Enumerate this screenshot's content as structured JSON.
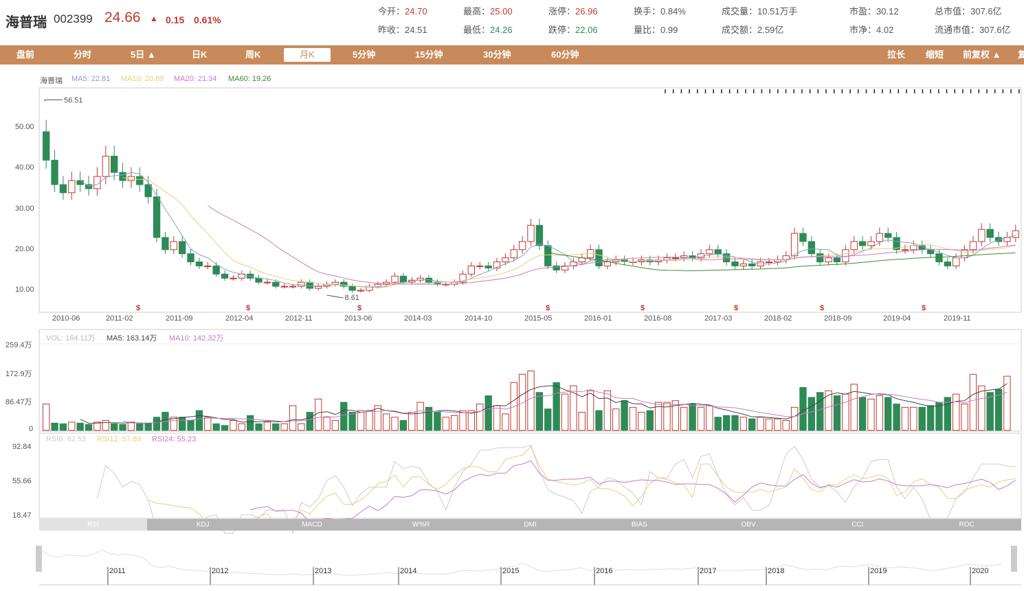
{
  "stock": {
    "name": "海普瑞",
    "code": "002399",
    "price": "24.66",
    "arrow": "▲",
    "change": "0.15",
    "change_pct": "0.61%"
  },
  "quote": {
    "row1": [
      {
        "label": "今开：",
        "value": "24.70",
        "tone": "up"
      },
      {
        "label": "最高：",
        "value": "25.00",
        "tone": "up"
      },
      {
        "label": "涨停：",
        "value": "26.96",
        "tone": "up"
      },
      {
        "label": "换手：",
        "value": "0.84%",
        "tone": "nt"
      },
      {
        "label": "成交量：",
        "value": "10.51万手",
        "tone": "nt"
      },
      {
        "label": "市盈：",
        "value": "30.12",
        "tone": "nt"
      },
      {
        "label": "总市值：",
        "value": "307.6亿",
        "tone": "nt"
      }
    ],
    "row2": [
      {
        "label": "昨收：",
        "value": "24.51",
        "tone": "nt"
      },
      {
        "label": "最低：",
        "value": "24.26",
        "tone": "dn"
      },
      {
        "label": "跌停：",
        "value": "22.06",
        "tone": "dn"
      },
      {
        "label": "量比：",
        "value": "0.99",
        "tone": "nt"
      },
      {
        "label": "成交额：",
        "value": "2.59亿",
        "tone": "nt"
      },
      {
        "label": "市净：",
        "value": "4.02",
        "tone": "nt"
      },
      {
        "label": "流通市值：",
        "value": "307.6亿",
        "tone": "nt"
      }
    ]
  },
  "toolbar": {
    "left": [
      "盘前",
      "分时",
      "5日 ▲",
      "日K",
      "周K",
      "月K",
      "5分钟",
      "15分钟",
      "30分钟",
      "60分钟"
    ],
    "active_index": 5,
    "right": [
      "拉长",
      "缩短",
      "前复权 ▲",
      "复"
    ]
  },
  "kline": {
    "legend": {
      "name": "海普瑞",
      "ma5": "MA5: 22.81",
      "ma10": "MA10: 20.89",
      "ma20": "MA20: 21.34",
      "ma60": "MA60: 19.26"
    },
    "yticks": [
      "50.00",
      "40.00",
      "30.00",
      "20.00",
      "10.00"
    ],
    "xticks": [
      "2010-06",
      "2011-02",
      "2011-09",
      "2012-04",
      "2012-11",
      "2013-06",
      "2014-03",
      "2014-10",
      "2015-05",
      "2016-01",
      "2016-08",
      "2017-03",
      "2018-02",
      "2018-09",
      "2019-04",
      "2019-11"
    ],
    "high_label": "56.51",
    "low_label": "8.61",
    "dividend_mark": "$"
  },
  "volume": {
    "legend": {
      "vol": "VOL: 164.11万",
      "ma5": "MA5: 163.14万",
      "ma10": "MA10: 142.32万"
    },
    "yticks": [
      "259.4万",
      "172.9万",
      "86.47万",
      "0"
    ]
  },
  "rsi": {
    "legend": {
      "rsi6": "RSI6: 62.53",
      "rsi12": "RSI12: 57.89",
      "rsi24": "RSI24: 55.23"
    },
    "yticks": [
      "92.84",
      "55.66",
      "18.47"
    ]
  },
  "indicator_tabs": [
    "RSI",
    "KDJ",
    "MACD",
    "W%R",
    "DMI",
    "BIAS",
    "OBV",
    "CCI",
    "ROC"
  ],
  "indicator_active": 0,
  "navigator_years": [
    "2011",
    "2012",
    "2013",
    "2014",
    "2015",
    "2016",
    "2017",
    "2018",
    "2019",
    "2020"
  ],
  "colors": {
    "up": "#c0392b",
    "down": "#2e8b57",
    "toolbar": "#c88a5a",
    "ma5": "#8aa0c8",
    "ma10": "#e3d27a",
    "ma20": "#c77bc7",
    "ma60": "#3a8a3a"
  },
  "chart_data": {
    "type": "candlestick",
    "period": "monthly",
    "price_close": [
      42,
      36,
      34,
      37,
      36,
      35,
      38,
      43,
      39,
      37,
      38,
      36,
      33,
      23,
      20,
      22,
      19,
      17,
      16,
      16,
      14,
      13,
      13,
      14,
      13,
      12,
      12,
      11,
      11,
      11,
      12,
      10.5,
      11,
      11.5,
      12,
      11,
      10,
      10,
      11,
      11.5,
      12,
      13.5,
      12,
      12.5,
      13,
      12,
      11.5,
      11.5,
      12,
      14,
      16,
      16,
      15.5,
      17,
      18,
      20,
      22,
      26,
      21,
      16,
      15,
      16,
      17,
      18,
      20,
      16,
      17,
      17.5,
      17,
      17,
      17.5,
      17,
      17.5,
      18,
      18,
      18.5,
      18,
      19,
      20,
      19,
      17,
      16,
      16.5,
      16,
      17,
      17,
      17.5,
      18.5,
      24,
      22,
      19,
      17,
      18,
      17,
      20,
      22,
      21,
      22,
      24,
      23,
      20,
      20,
      21,
      20,
      19,
      17,
      16,
      18,
      20,
      22,
      25,
      23,
      22,
      23,
      24.66
    ],
    "volume_wan": [
      80,
      22,
      20,
      25,
      22,
      18,
      25,
      30,
      20,
      18,
      25,
      20,
      22,
      40,
      55,
      40,
      40,
      30,
      60,
      40,
      20,
      15,
      30,
      20,
      45,
      20,
      25,
      20,
      20,
      75,
      20,
      55,
      95,
      40,
      30,
      85,
      55,
      60,
      60,
      75,
      50,
      40,
      30,
      55,
      85,
      70,
      55,
      40,
      45,
      60,
      60,
      80,
      105,
      75,
      50,
      145,
      170,
      180,
      115,
      65,
      145,
      110,
      135,
      55,
      120,
      60,
      120,
      65,
      90,
      70,
      55,
      60,
      85,
      85,
      90,
      70,
      80,
      70,
      75,
      40,
      45,
      45,
      40,
      35,
      40,
      35,
      35,
      30,
      70,
      130,
      100,
      115,
      120,
      105,
      110,
      140,
      100,
      95,
      105,
      100,
      80,
      70,
      70,
      70,
      75,
      85,
      100,
      110,
      80,
      170,
      135,
      115,
      125,
      164.11
    ]
  }
}
